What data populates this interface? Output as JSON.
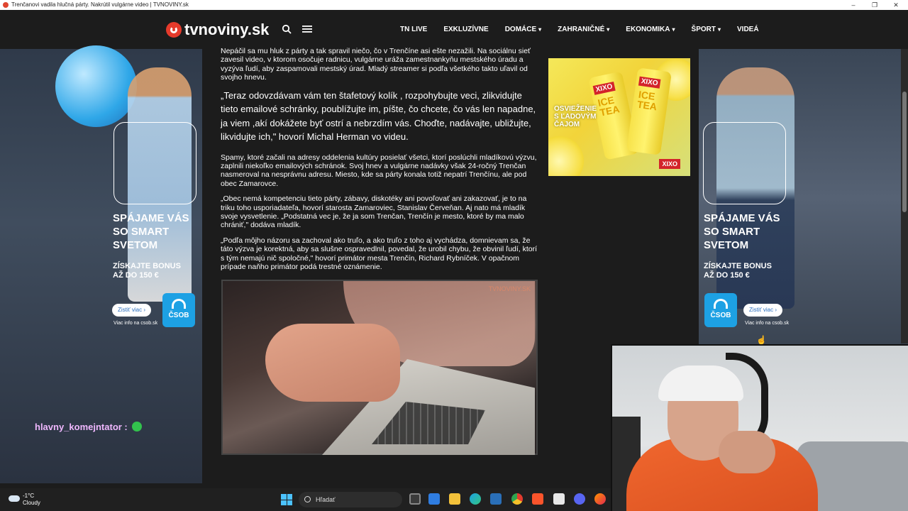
{
  "window": {
    "title": "Trenčanovi vadila hlučná párty. Nakrútil vulgárne video | TVNOVINY.sk",
    "controls": [
      "–",
      "❐",
      "✕"
    ]
  },
  "site": {
    "logo_text": "tvnoviny.sk",
    "nav": [
      {
        "label": "TN LIVE",
        "has_dropdown": false
      },
      {
        "label": "EXKLUZÍVNE",
        "has_dropdown": false
      },
      {
        "label": "DOMÁCE",
        "has_dropdown": true
      },
      {
        "label": "ZAHRANIČNÉ",
        "has_dropdown": true
      },
      {
        "label": "EKONOMIKA",
        "has_dropdown": true
      },
      {
        "label": "ŠPORT",
        "has_dropdown": true
      },
      {
        "label": "VIDEÁ",
        "has_dropdown": false
      }
    ]
  },
  "article": {
    "p1": "Nepáčil sa mu hluk z párty a tak spravil niečo, čo v Trenčíne asi ešte nezažili. Na sociálnu sieť zavesil video, v ktorom osočuje radnicu, vulgárne uráža zamestnankyňu mestského úradu a vyzýva ľudí, aby zaspamovali mestský úrad. Mladý streamer si podľa všetkého takto uľavil od svojho hnevu.",
    "quote": "„Teraz odovzdávam vám ten štafetový kolík , rozpohybujte veci, zlikvidujte tieto emailové schránky, poublížujte im, píšte, čo chcete, čo vás len napadne, ja viem ,akí dokážete byť ostrí a nebrzdím vás. Choďte, nadávajte, ubližujte, likvidujte ich,\" hovorí Michal Herman vo videu.",
    "p2": "Spamy, ktoré začali na adresy oddelenia kultúry posielať všetci, ktorí poslúchli mladíkovú výzvu, zaplnili niekoľko emailových schránok. Svoj hnev a vulgárne nadávky však 24-ročný Trenčan nasmeroval na nesprávnu adresu. Miesto, kde sa párty konala totiž nepatrí Trenčínu, ale pod obec Zamarovce.",
    "p3": "„Obec nemá kompetenciu tieto párty, zábavy, diskotéky ani povoľovať ani zakazovať, je to na triku toho usporiadateľa, hovorí starosta Zamaroviec, Stanislav Červeňan. Aj nato má mladík svoje vysvetlenie. „Podstatná vec je, že ja som Trenčan, Trenčín je mesto, ktoré by ma malo chrániť,\" dodáva mladík.",
    "p4": "„Podľa môjho názoru sa zachoval ako truľo, a ako truľo z toho aj vychádza, domnievam sa, že táto výzva je korektná, aby sa slušne ospravedlnil, povedal, že urobil chybu, že obvinil ľudí, ktorí s tým nemajú nič spoločné,\" hovorí primátor mesta Trenčín, Richard Rybníček. V opačnom prípade naňho primátor podá trestné oznámenie.",
    "video_watermark": "TVNOVINY.SK"
  },
  "ad_xixo": {
    "text": "OSVIEŽENIE S ĽADOVÝM ČAJOM",
    "brand": "XIXO",
    "can_label": "ICE TEA"
  },
  "promo": {
    "headline_1": "SPÁJAME VÁS",
    "headline_2": "SO SMART",
    "headline_3": "SVETOM",
    "bonus_1": "ZÍSKAJTE BONUS",
    "bonus_2": "AŽ DO 150 €",
    "button": "Zistiť viac",
    "bank": "ČSOB",
    "info": "Viac info na csob.sk"
  },
  "chat": {
    "username": "hlavny_komejntator :"
  },
  "taskbar": {
    "temperature": "-1°C",
    "condition": "Cloudy",
    "search_placeholder": "Hľadať"
  },
  "colors": {
    "accent": "#e53a2b",
    "page_bg": "#1c1c1c",
    "csob_blue": "#1da1e4"
  }
}
